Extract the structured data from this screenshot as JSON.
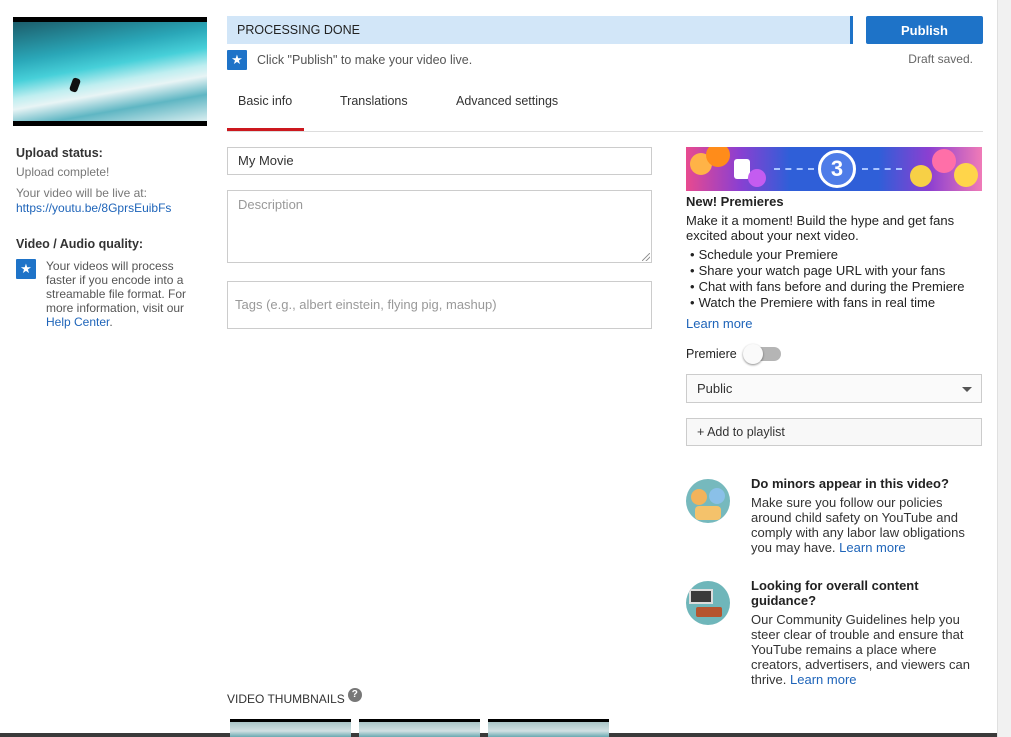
{
  "processing": {
    "status": "PROCESSING DONE",
    "hint": "Click \"Publish\" to make your video live."
  },
  "actions": {
    "publish": "Publish",
    "draft_saved": "Draft saved."
  },
  "upload": {
    "status_label": "Upload status:",
    "status_value": "Upload complete!",
    "live_at_label": "Your video will be live at:",
    "url": "https://youtu.be/8GprsEuibFs"
  },
  "quality": {
    "label": "Video / Audio quality:",
    "text": "Your videos will process faster if you encode into a streamable file format. For more information, visit our",
    "link": "Help Center",
    "link_suffix": "."
  },
  "tabs": [
    "Basic info",
    "Translations",
    "Advanced settings"
  ],
  "form": {
    "title_value": "My Movie",
    "description_placeholder": "Description",
    "tags_placeholder": "Tags (e.g., albert einstein, flying pig, mashup)"
  },
  "premieres": {
    "banner_number": "3",
    "title": "New! Premieres",
    "body": "Make it a moment! Build the hype and get fans excited about your next video.",
    "bullets": [
      "Schedule your Premiere",
      "Share your watch page URL with your fans",
      "Chat with fans before and during the Premiere",
      "Watch the Premiere with fans in real time"
    ],
    "learn_more": "Learn more",
    "toggle_label": "Premiere",
    "toggle_on": false
  },
  "visibility": {
    "selected": "Public"
  },
  "playlist": {
    "add_label": "+ Add to playlist"
  },
  "minors": {
    "title": "Do minors appear in this video?",
    "body": "Make sure you follow our policies around child safety on YouTube and comply with any labor law obligations you may have.",
    "learn_more": "Learn more"
  },
  "guidance": {
    "title": "Looking for overall content guidance?",
    "body": "Our Community Guidelines help you steer clear of trouble and ensure that YouTube remains a place where creators, advertisers, and viewers can thrive.",
    "learn_more": "Learn more"
  },
  "thumbnails": {
    "label": "VIDEO THUMBNAILS",
    "help_glyph": "?"
  },
  "colors": {
    "accent": "#1e73c8",
    "tab_active": "#cc181e",
    "status_bar": "#d2e6f8",
    "link": "#1e64b9"
  },
  "icons": [
    "star-icon",
    "help-icon",
    "chevron-down-icon",
    "children-illustration-icon",
    "guidelines-illustration-icon"
  ]
}
